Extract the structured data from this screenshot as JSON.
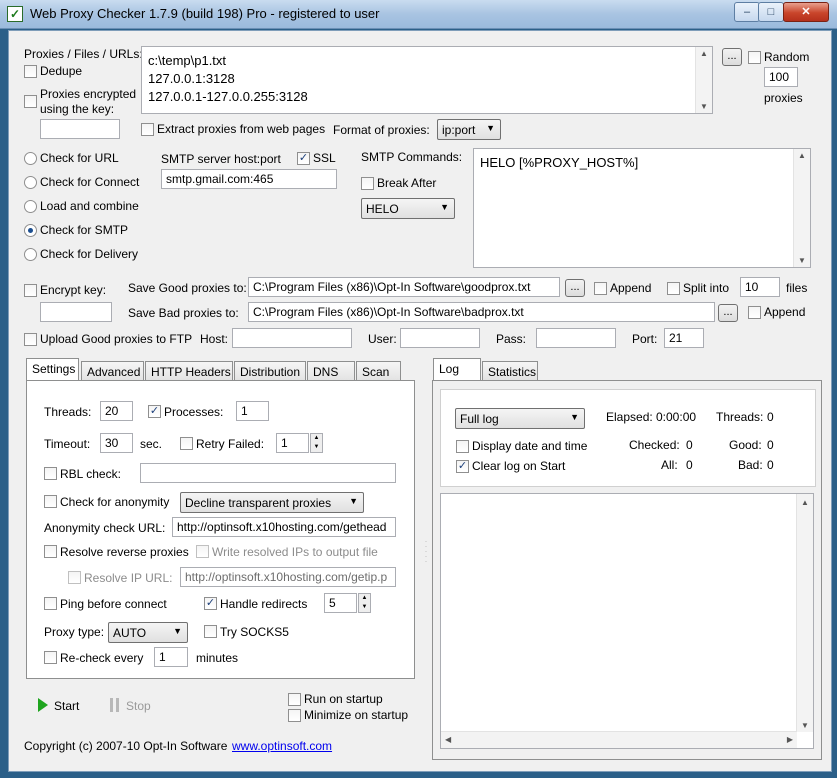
{
  "window": {
    "title": "Web Proxy Checker 1.7.9 (build 198) Pro - registered to user",
    "min": "–",
    "max": "□",
    "close": "✕"
  },
  "proxies": {
    "label": "Proxies / Files / URLs:",
    "list": [
      "c:\\temp\\p1.txt",
      "127.0.0.1:3128",
      "127.0.0.1-127.0.0.255:3128"
    ],
    "browse": "...",
    "random_label": "Random",
    "random_count": "100",
    "random_unit": "proxies",
    "dedupe": "Dedupe",
    "encrypted": "Proxies encrypted using the key:",
    "key_value": "",
    "extract": "Extract proxies from web pages",
    "format_label": "Format of proxies:",
    "format_value": "ip:port"
  },
  "modes": {
    "items": [
      "Check for URL",
      "Check for Connect",
      "Load and combine",
      "Check for SMTP",
      "Check for Delivery"
    ],
    "selected": "Check for SMTP"
  },
  "smtp": {
    "host_label": "SMTP server host:port",
    "host_value": "smtp.gmail.com:465",
    "ssl": "SSL",
    "commands_label": "SMTP Commands:",
    "break_after": "Break After",
    "break_cmd": "HELO",
    "commands_text": "HELO [%PROXY_HOST%]"
  },
  "save": {
    "encrypt_key": "Encrypt key:",
    "good_label": "Save Good proxies to:",
    "good_path": "C:\\Program Files (x86)\\Opt-In Software\\goodprox.txt",
    "bad_label": "Save Bad proxies to:",
    "bad_path": "C:\\Program Files (x86)\\Opt-In Software\\badprox.txt",
    "browse": "...",
    "append": "Append",
    "split_into": "Split into",
    "split_count": "10",
    "split_unit": "files"
  },
  "ftp": {
    "upload": "Upload Good proxies to FTP",
    "host_label": "Host:",
    "user_label": "User:",
    "pass_label": "Pass:",
    "port_label": "Port:",
    "port_value": "21"
  },
  "settings_tabs": [
    "Settings",
    "Advanced",
    "HTTP Headers",
    "Distribution",
    "DNS",
    "Scan"
  ],
  "settings": {
    "threads_label": "Threads:",
    "threads": "20",
    "processes_label": "Processes:",
    "processes": "1",
    "timeout_label": "Timeout:",
    "timeout": "30",
    "sec": "sec.",
    "retry_label": "Retry Failed:",
    "retry": "1",
    "rbl": "RBL check:",
    "anonymity": "Check for anonymity",
    "anonymity_mode": "Decline transparent proxies",
    "anon_url_label": "Anonymity check URL:",
    "anon_url": "http://optinsoft.x10hosting.com/gethead",
    "resolve_reverse": "Resolve reverse proxies",
    "write_resolved": "Write resolved IPs to output file",
    "resolve_ip_label": "Resolve IP URL:",
    "resolve_ip_url": "http://optinsoft.x10hosting.com/getip.p",
    "ping": "Ping before connect",
    "redirects": "Handle redirects",
    "redirects_count": "5",
    "proxy_type_label": "Proxy type:",
    "proxy_type": "AUTO",
    "socks5": "Try SOCKS5",
    "recheck": "Re-check every",
    "recheck_value": "1",
    "minutes": "minutes"
  },
  "controls": {
    "start": "Start",
    "stop": "Stop",
    "run_startup": "Run on startup",
    "minimize_startup": "Minimize on startup"
  },
  "footer": {
    "copyright": "Copyright (c) 2007-10 Opt-In Software",
    "link": "www.optinsoft.com"
  },
  "log_tabs": [
    "Log",
    "Statistics"
  ],
  "log": {
    "mode": "Full log",
    "elapsed_label": "Elapsed:",
    "elapsed": "0:00:00",
    "threads_label": "Threads:",
    "threads": "0",
    "display_date": "Display date and time",
    "clear_log": "Clear log on Start",
    "checked_label": "Checked:",
    "checked": "0",
    "good_label": "Good:",
    "good": "0",
    "all_label": "All:",
    "all": "0",
    "bad_label": "Bad:",
    "bad": "0"
  }
}
